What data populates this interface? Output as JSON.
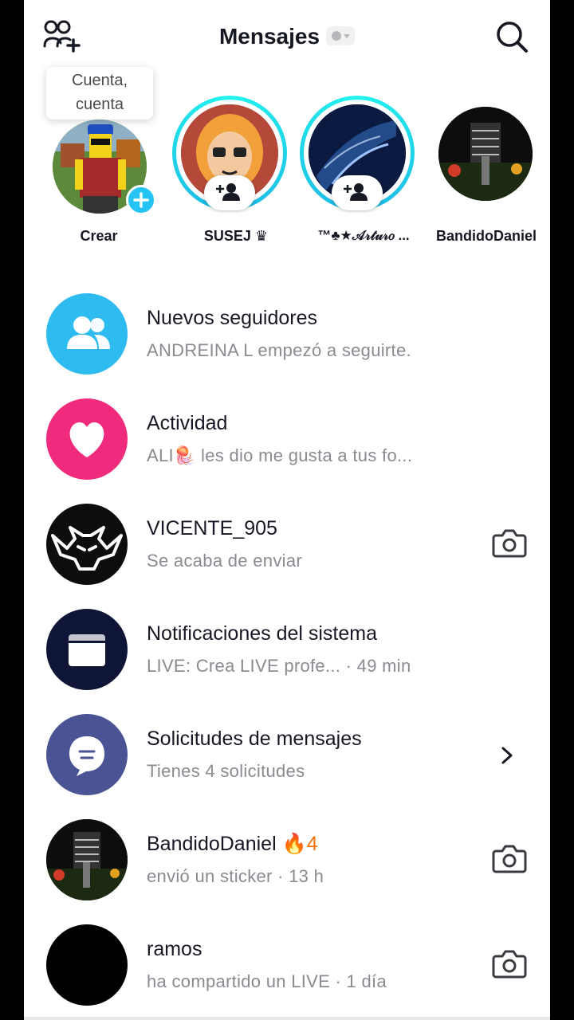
{
  "header": {
    "title": "Mensajes",
    "left_icon": "add-friends-icon",
    "right_icon": "search-icon"
  },
  "stories": {
    "tooltip": [
      "Cuenta,",
      "cuenta"
    ],
    "items": [
      {
        "name": "Crear",
        "badge": "plus"
      },
      {
        "name": "SUSEJ ♛",
        "badge": "follow"
      },
      {
        "name": "™♣★𝒜𝓇𝓉𝓊𝓇𝑜 ...",
        "badge": "follow"
      },
      {
        "name": "BandidoDaniel",
        "badge": "none"
      }
    ]
  },
  "inbox": [
    {
      "title": "Nuevos seguidores",
      "subtitle": "ANDREINA L empezó a seguirte.",
      "icon": "followers-icon",
      "color": "#2dbbf0"
    },
    {
      "title": "Actividad",
      "subtitle": "ALI🪼 les dio me gusta a tus fo...",
      "icon": "heart-icon",
      "color": "#f02a7c"
    },
    {
      "title": "VICENTE_905",
      "subtitle": "Se acaba de enviar",
      "icon": "fox-logo-avatar",
      "action": "camera-icon"
    },
    {
      "title": "Notificaciones del sistema",
      "subtitle": "LIVE: Crea LIVE profe...  · 49 min",
      "icon": "inbox-icon",
      "color": "#0e1536"
    },
    {
      "title": "Solicitudes de mensajes",
      "subtitle": "Tienes 4 solicitudes",
      "icon": "chat-bubble-icon",
      "color": "#4a5394",
      "action": "chevron-right-icon"
    },
    {
      "title": "BandidoDaniel",
      "streak_icon": "🔥",
      "streak_count": "4",
      "subtitle": "envió un sticker · 13 h",
      "icon": "bandido-avatar",
      "action": "camera-icon"
    },
    {
      "title": "ramos",
      "subtitle": "ha compartido un LIVE · 1 día",
      "icon": "black-avatar",
      "action": "camera-icon"
    }
  ],
  "colors": {
    "accent_cyan": "#25c4f4",
    "ring_gradient": [
      "#25f4ee",
      "#1db4e6"
    ],
    "streak_orange": "#f5740a",
    "subtitle_gray": "#8a8b91"
  }
}
